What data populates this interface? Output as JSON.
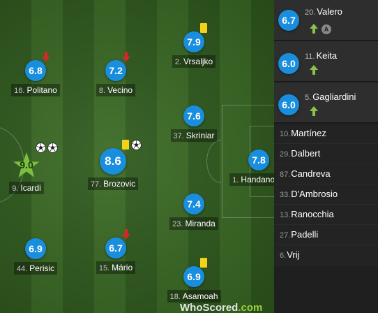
{
  "starters": [
    {
      "id": "politano",
      "num": "16.",
      "name": "Politano",
      "rating": "6.8",
      "events": [
        "sub-off"
      ]
    },
    {
      "id": "vecino",
      "num": "8.",
      "name": "Vecino",
      "rating": "7.2",
      "events": [
        "sub-off"
      ]
    },
    {
      "id": "vrsaljko",
      "num": "2.",
      "name": "Vrsaljko",
      "rating": "7.9",
      "events": [
        "yellow-card"
      ]
    },
    {
      "id": "skriniar",
      "num": "37.",
      "name": "Skriniar",
      "rating": "7.6",
      "events": []
    },
    {
      "id": "icardi",
      "num": "9.",
      "name": "Icardi",
      "rating": "9.0",
      "events": [
        "goal",
        "goal"
      ],
      "man_of_match": true
    },
    {
      "id": "brozovic",
      "num": "77.",
      "name": "Brozovic",
      "rating": "8.6",
      "events": [
        "yellow-card",
        "goal"
      ]
    },
    {
      "id": "handanovic",
      "num": "1.",
      "name": "Handanovic",
      "rating": "7.8",
      "events": []
    },
    {
      "id": "miranda",
      "num": "23.",
      "name": "Miranda",
      "rating": "7.4",
      "events": []
    },
    {
      "id": "perisic",
      "num": "44.",
      "name": "Perisic",
      "rating": "6.9",
      "events": []
    },
    {
      "id": "mario",
      "num": "15.",
      "name": "Mário",
      "rating": "6.7",
      "events": [
        "sub-off"
      ]
    },
    {
      "id": "asamoah",
      "num": "18.",
      "name": "Asamoah",
      "rating": "6.9",
      "events": [
        "yellow-card"
      ]
    }
  ],
  "substitutes_used": [
    {
      "num": "20.",
      "name": "Valero",
      "rating": "6.7",
      "events": [
        "sub-on",
        "captain"
      ],
      "captain_label": "A"
    },
    {
      "num": "11.",
      "name": "Keita",
      "rating": "6.0",
      "events": [
        "sub-on"
      ]
    },
    {
      "num": "5.",
      "name": "Gagliardini",
      "rating": "6.0",
      "events": [
        "sub-on"
      ]
    }
  ],
  "bench": [
    {
      "num": "10.",
      "name": "Martínez"
    },
    {
      "num": "29.",
      "name": "Dalbert"
    },
    {
      "num": "87.",
      "name": "Candreva"
    },
    {
      "num": "33.",
      "name": "D'Ambrosio"
    },
    {
      "num": "13.",
      "name": "Ranocchia"
    },
    {
      "num": "27.",
      "name": "Padelli"
    },
    {
      "num": "6.",
      "name": "Vrij"
    }
  ],
  "logo": {
    "text_a": "WhoScored",
    "text_b": ".com"
  },
  "colors": {
    "rating_blue": "#1a8ede",
    "sub_off_red": "#d9252b",
    "sub_on_green": "#8bc34a",
    "yellow_card": "#f4d21a",
    "mom_star": "#7bc043",
    "pitch_dark": "#2f5a1d",
    "pitch_light": "#3a6a24"
  },
  "icons": {
    "sub-off": "red-down-arrow-icon",
    "sub-on": "green-up-arrow-icon",
    "goal": "football-icon",
    "yellow-card": "yellow-card-icon",
    "captain": "captain-badge-icon"
  }
}
